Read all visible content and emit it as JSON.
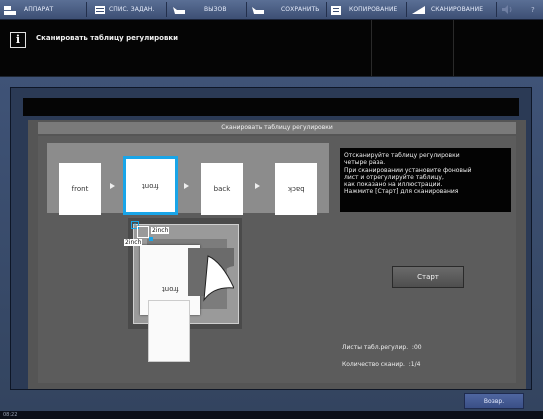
{
  "topbar": {
    "items": [
      {
        "label": "АППАРАТ"
      },
      {
        "label": "СПИС. ЗАДАН."
      },
      {
        "label": "ВЫЗОВ"
      },
      {
        "label": "СОХРАНИТЬ"
      },
      {
        "label": "КОПИРОВАНИЕ"
      },
      {
        "label": "СКАНИРОВАНИЕ"
      }
    ],
    "help_label": "?"
  },
  "info": {
    "icon": "i",
    "message": "Сканировать таблицу регулировки"
  },
  "dialog": {
    "title": "Сканировать таблицу регулировки",
    "sheets": [
      "front",
      "front",
      "back",
      "back"
    ],
    "instructions": "Отсканируйте таблицу регулировки\nчетыре раза.\nПри сканировании установите фоновый\nлист и отрегулируйте таблицу,\nкак показано на иллюстрации.\nНажмите [Старт] для сканирования",
    "measure_h": "2inch",
    "measure_v": "2inch",
    "doc_label": "front",
    "start_label": "Старт",
    "stat_sheets": "Листы табл.регулир.  :00",
    "stat_count": "Количество сканир.  :1/4"
  },
  "back_label": "Возвр.",
  "clock": "08:22",
  "colors": {
    "accent": "#19a5e8",
    "topbar": "#4b5f86"
  }
}
